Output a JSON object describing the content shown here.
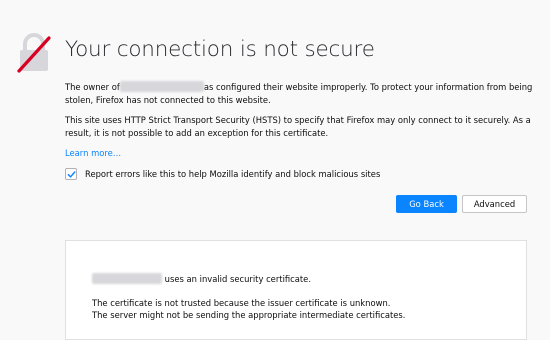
{
  "page": {
    "title": "Your connection is not secure",
    "icon": "broken-lock-icon"
  },
  "intro": {
    "before": "The owner of",
    "after": "as configured their website improperly. To protect your information from being stolen, Firefox has not connected to this website."
  },
  "hsts_text": "This site uses HTTP Strict Transport Security (HSTS) to specify that Firefox may only connect to it securely. As a result, it is not possible to add an exception for this certificate.",
  "learn_more": "Learn more…",
  "report": {
    "checked": true,
    "label": "Report errors like this to help Mozilla identify and block malicious sites"
  },
  "buttons": {
    "go_back": "Go Back",
    "advanced": "Advanced"
  },
  "details": {
    "invalid_cert": "uses an invalid security certificate.",
    "not_trusted": "The certificate is not trusted because the issuer certificate is unknown.",
    "intermediate": "The server might not be sending the appropriate intermediate certificates."
  },
  "colors": {
    "accent": "#0a84ff",
    "lock_gray": "#d7d7db",
    "slash_red": "#d70022",
    "background": "#f9f9fa"
  }
}
